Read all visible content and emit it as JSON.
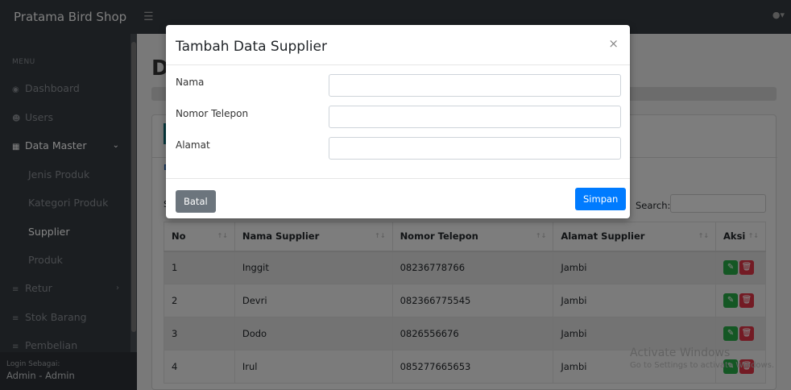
{
  "app": {
    "brand": "Pratama Bird Shop"
  },
  "sidebar": {
    "menu_heading": "MENU",
    "items": [
      {
        "label": "Dashboard",
        "icon": "dashboard-icon"
      },
      {
        "label": "Users",
        "icon": "users-icon"
      },
      {
        "label": "Data Master",
        "icon": "database-icon"
      },
      {
        "label": "Jenis Produk"
      },
      {
        "label": "Kategori Produk"
      },
      {
        "label": "Supplier"
      },
      {
        "label": "Produk"
      },
      {
        "label": "Retur",
        "icon": "list-icon"
      },
      {
        "label": "Stok Barang",
        "icon": "list-icon"
      },
      {
        "label": "Pembelian",
        "icon": "list-icon"
      }
    ],
    "login_label": "Login Sebagai:",
    "login_user": "Admin - Admin"
  },
  "main": {
    "page_title_initial": "D",
    "card_link_initial": "D",
    "show_initial": "S",
    "search_label": "Search:"
  },
  "table": {
    "headers": [
      "No",
      "Nama Supplier",
      "Nomor Telepon",
      "Alamat Supplier",
      "Aksi"
    ],
    "rows": [
      {
        "no": "1",
        "nama": "Inggit",
        "telepon": "08236778766",
        "alamat": "Jambi"
      },
      {
        "no": "2",
        "nama": "Devri",
        "telepon": "082366775545",
        "alamat": "Jambi"
      },
      {
        "no": "3",
        "nama": "Dodo",
        "telepon": "0826556676",
        "alamat": "Jambi"
      },
      {
        "no": "4",
        "nama": "Irul",
        "telepon": "085277665653",
        "alamat": "Jambi"
      }
    ]
  },
  "modal": {
    "title": "Tambah Data Supplier",
    "close_glyph": "×",
    "fields": [
      {
        "label": "Nama",
        "value": ""
      },
      {
        "label": "Nomor Telepon",
        "value": ""
      },
      {
        "label": "Alamat",
        "value": ""
      }
    ],
    "cancel_label": "Batal",
    "submit_label": "Simpan"
  },
  "watermark": {
    "line1": "Activate Windows",
    "line2": "Go to Settings to activate Windows."
  },
  "colors": {
    "navbar": "#343a40",
    "primary": "#007bff",
    "secondary": "#6c757d",
    "success": "#28a745",
    "danger": "#dc3545"
  }
}
